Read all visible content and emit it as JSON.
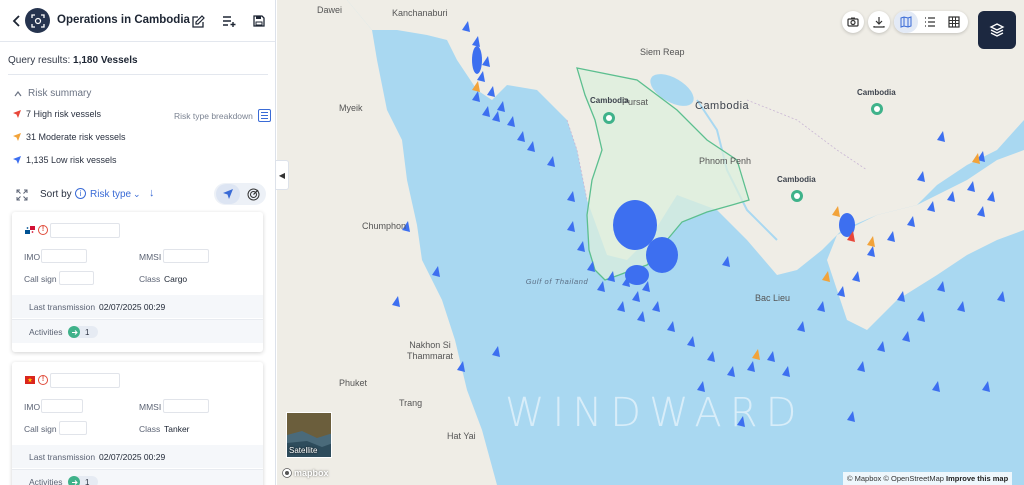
{
  "header": {
    "title": "Operations in Cambodia"
  },
  "query": {
    "label": "Query results:",
    "count": "1,180 Vessels"
  },
  "risk_summary": {
    "title": "Risk summary",
    "high": "7 High risk vessels",
    "moderate": "31 Moderate risk vessels",
    "low": "1,135 Low risk vessels",
    "breakdown_label": "Risk type breakdown",
    "colors": {
      "high": "#e8473a",
      "moderate": "#f2a33a",
      "low": "#3d6ff0"
    }
  },
  "sort": {
    "label": "Sort by",
    "value": "Risk type"
  },
  "vessels": [
    {
      "flag": "panama",
      "imo_label": "IMO",
      "mmsi_label": "MMSI",
      "callsign_label": "Call sign",
      "class_label": "Class",
      "class_value": "Cargo",
      "last_label": "Last transmission",
      "last_value": "02/07/2025 00:29",
      "activities_label": "Activities",
      "activities_count": "1"
    },
    {
      "flag": "vietnam",
      "imo_label": "IMO",
      "mmsi_label": "MMSI",
      "callsign_label": "Call sign",
      "class_label": "Class",
      "class_value": "Tanker",
      "last_label": "Last transmission",
      "last_value": "02/07/2025 00:29",
      "activities_label": "Activities",
      "activities_count": "1"
    }
  ],
  "map": {
    "labels": {
      "dawei": "Dawei",
      "kanchanaburi": "Kanchanaburi",
      "siem_reap": "Siem Reap",
      "pursat": "Pursat",
      "cambodia": "Cambodia",
      "cambodia_marker_1": "Cambodia",
      "cambodia_marker_2": "Cambodia",
      "cambodia_marker_3": "Cambodia",
      "myeik": "Myeik",
      "phnom_penh": "Phnom Penh",
      "chumphon": "Chumphon",
      "gulf": "Gulf of Thailand",
      "bac_lieu": "Bac Lieu",
      "nakhon": "Nakhon Si Thammarat",
      "phuket": "Phuket",
      "trang": "Trang",
      "hat_yai": "Hat Yai"
    },
    "watermark": "WINDWARD",
    "satellite_label": "Satellite",
    "mapbox_logo": "mapbox",
    "attribution": {
      "mapbox": "© Mapbox",
      "osm": "© OpenStreetMap",
      "improve": "Improve this map"
    },
    "colors": {
      "sea": "#a8d8f0",
      "land": "#f0eee6",
      "aoi_fill": "#dcefdc",
      "aoi_stroke": "#5cbf8f",
      "vessel": "#3d6ff0"
    }
  }
}
